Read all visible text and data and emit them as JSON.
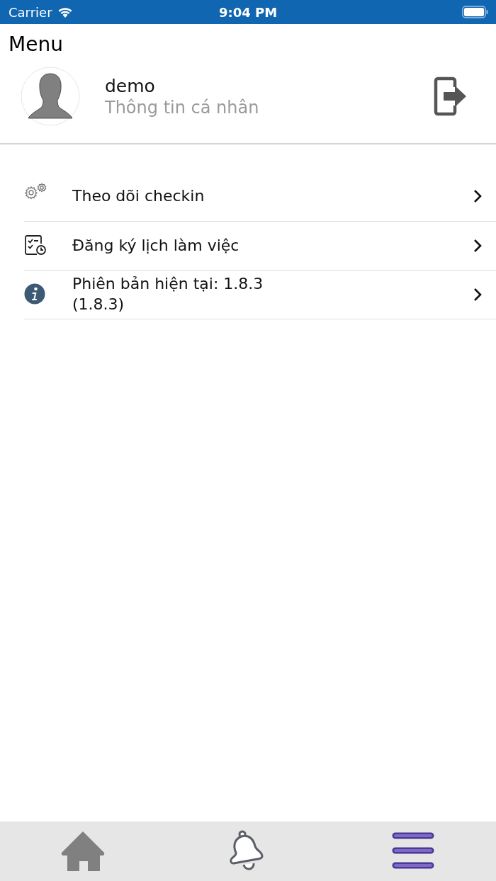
{
  "status_bar": {
    "carrier": "Carrier",
    "time": "9:04 PM"
  },
  "title": "Menu",
  "profile": {
    "name": "demo",
    "subtitle": "Thông tin cá nhân"
  },
  "menu_items": [
    {
      "kind": "gears",
      "label": "Theo dõi checkin"
    },
    {
      "kind": "schedule",
      "label": "Đăng ký lịch làm việc"
    },
    {
      "kind": "info",
      "label": "Phiên bản hiện tại: 1.8.3\n(1.8.3)"
    }
  ],
  "tab_bar": [
    {
      "kind": "home",
      "selected": false
    },
    {
      "kind": "bell",
      "selected": false
    },
    {
      "kind": "menu",
      "selected": true
    }
  ]
}
